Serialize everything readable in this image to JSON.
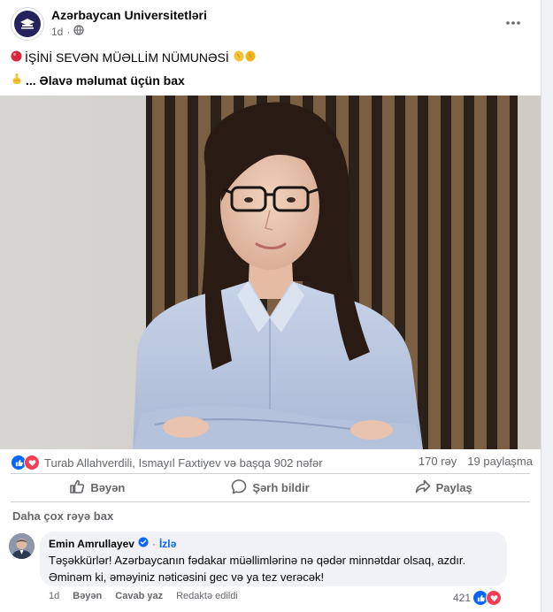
{
  "post": {
    "page_name": "Azərbaycan Universitetləri",
    "time": "1d",
    "privacy_icon": "globe-icon",
    "headline_emoji": "red-circle",
    "headline": "İŞİNİ SEVƏN MÜƏLLİM NÜMUNƏSİ",
    "headline_trailing_emoji": "clapping-hands",
    "link_emoji": "pointing-hand",
    "more_text": "... Əlavə məlumat üçün bax"
  },
  "stats": {
    "reaction_icons": [
      "like-icon",
      "love-icon"
    ],
    "reactors": "Turab Allahverdili, Ismayıl Faxtiyev və başqa 902 nəfər",
    "comments": "170 rəy",
    "shares": "19 paylaşma"
  },
  "actions": {
    "like": "Bəyən",
    "comment": "Şərh bildir",
    "share": "Paylaş"
  },
  "comments": {
    "more_label": "Daha çox rəyə bax",
    "items": [
      {
        "author": "Emin Amrullayev",
        "verified": true,
        "follow": "İzlə",
        "line1": "Təşəkkürlər! Azərbaycanın fədakar müəllimlərinə nə qədər minnətdar olsaq, azdır.",
        "line2": "Əminəm ki, əməyiniz nəticəsini gec və ya tez verəcək!",
        "time": "1d",
        "like": "Bəyən",
        "reply": "Cavab yaz",
        "edited": "Redaktə edildi",
        "reaction_count": "421"
      }
    ]
  },
  "colors": {
    "facebook_blue": "#0866ff",
    "love_red": "#f33e58",
    "secondary_text": "#65676b"
  }
}
